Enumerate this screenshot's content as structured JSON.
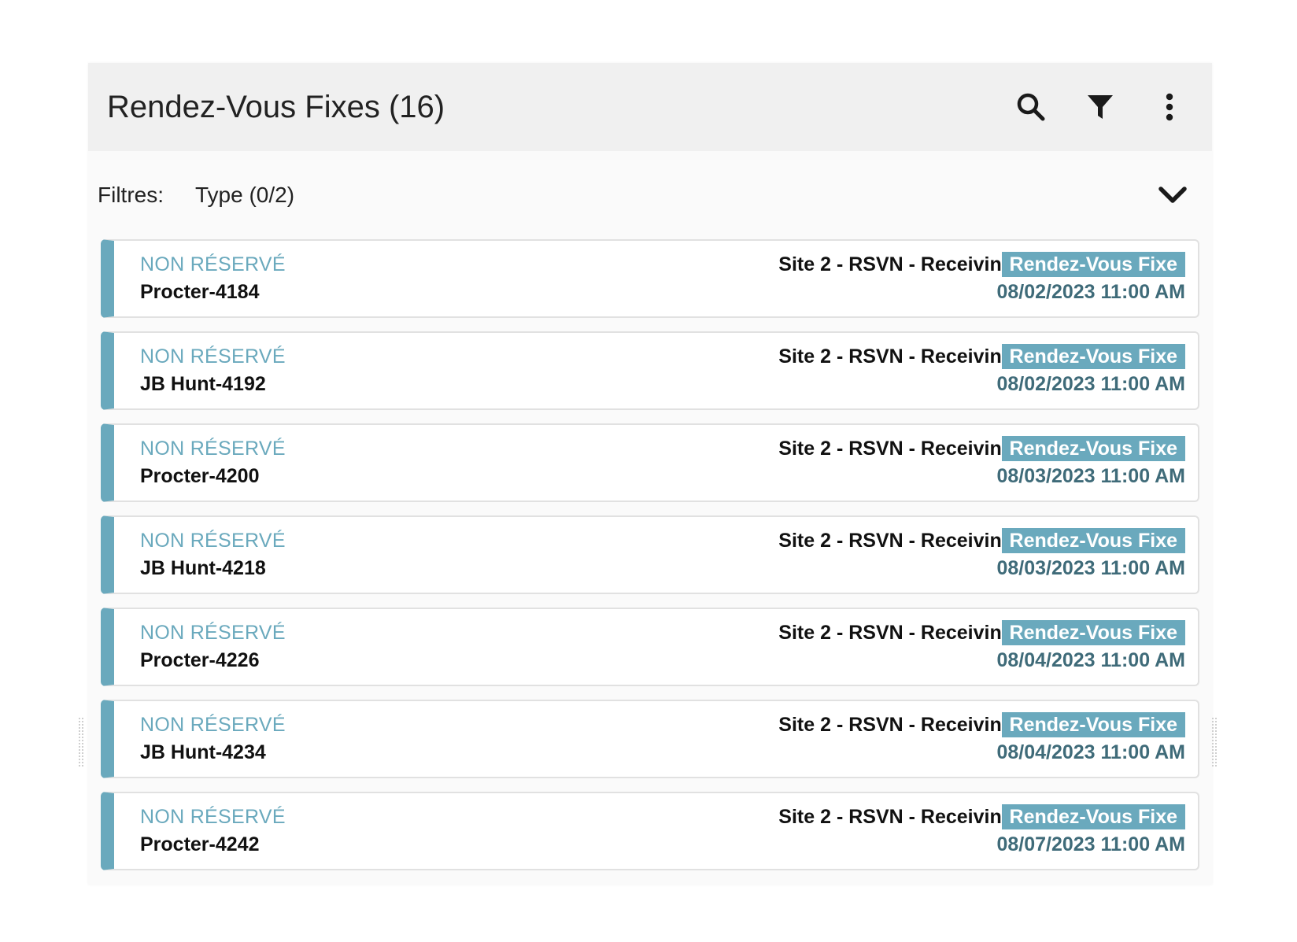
{
  "header": {
    "title": "Rendez-Vous Fixes (16)"
  },
  "filters": {
    "label": "Filtres:",
    "chips": [
      "Type (0/2)"
    ]
  },
  "cards": [
    {
      "status": "NON RÉSERVÉ",
      "name": "Procter-4184",
      "site": "Site 2 - RSVN - Receiving",
      "badge": "Rendez-Vous Fixe",
      "date": "08/02/2023 11:00 AM"
    },
    {
      "status": "NON RÉSERVÉ",
      "name": "JB Hunt-4192",
      "site": "Site 2 - RSVN - Receiving",
      "badge": "Rendez-Vous Fixe",
      "date": "08/02/2023 11:00 AM"
    },
    {
      "status": "NON RÉSERVÉ",
      "name": "Procter-4200",
      "site": "Site 2 - RSVN - Receiving",
      "badge": "Rendez-Vous Fixe",
      "date": "08/03/2023 11:00 AM"
    },
    {
      "status": "NON RÉSERVÉ",
      "name": "JB Hunt-4218",
      "site": "Site 2 - RSVN - Receiving",
      "badge": "Rendez-Vous Fixe",
      "date": "08/03/2023 11:00 AM"
    },
    {
      "status": "NON RÉSERVÉ",
      "name": "Procter-4226",
      "site": "Site 2 - RSVN - Receiving",
      "badge": "Rendez-Vous Fixe",
      "date": "08/04/2023 11:00 AM"
    },
    {
      "status": "NON RÉSERVÉ",
      "name": "JB Hunt-4234",
      "site": "Site 2 - RSVN - Receiving",
      "badge": "Rendez-Vous Fixe",
      "date": "08/04/2023 11:00 AM"
    },
    {
      "status": "NON RÉSERVÉ",
      "name": "Procter-4242",
      "site": "Site 2 - RSVN - Receiving",
      "badge": "Rendez-Vous Fixe",
      "date": "08/07/2023 11:00 AM"
    }
  ],
  "icons": {
    "search": "search-icon",
    "filter": "filter-icon",
    "more": "more-vertical-icon",
    "expand": "chevron-down-icon"
  },
  "colors": {
    "accent": "#6aa9bd",
    "date": "#3f6b79",
    "header_bg": "#f0f0f0"
  }
}
